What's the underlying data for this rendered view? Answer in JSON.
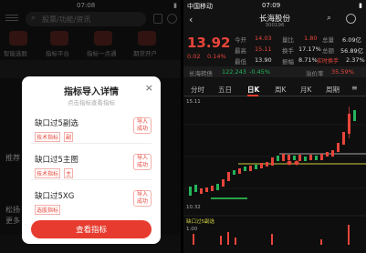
{
  "left": {
    "status": {
      "time": "07:08"
    },
    "search_placeholder": "股票/功能/资讯",
    "nav_items": [
      "智能选股",
      "指标平台",
      "指标一点通",
      "期货开户"
    ],
    "bg_labels": [
      "推荐",
      "松扬",
      "更多"
    ],
    "modal": {
      "title": "指标导入详情",
      "subtitle": "点击指标查看指标",
      "items": [
        {
          "name": "缺口过5副选",
          "tag1": "技术指标",
          "tag2": "副",
          "status": "导入\n成功"
        },
        {
          "name": "缺口过5主图",
          "tag1": "技术指标",
          "tag2": "主",
          "status": "导入\n成功"
        },
        {
          "name": "缺口过5XG",
          "tag1": "选股指标",
          "tag2": "",
          "status": "导入\n成功"
        }
      ],
      "button": "查看指标",
      "close": "×"
    }
  },
  "right": {
    "status": {
      "carrier": "中国移动",
      "time": "07:09"
    },
    "stock_name": "长海股份",
    "stock_code": "300196",
    "price": "13.92",
    "change": "0.02",
    "change_pct": "0.14%",
    "stats": [
      [
        "今开",
        "14.03",
        "量比",
        "1.80",
        "总量",
        "6.09亿"
      ],
      [
        "最高",
        "15.11",
        "换手",
        "17.17%",
        "总额",
        "56.89亿"
      ],
      [
        "最低",
        "13.90",
        "振幅",
        "8.71%",
        "实时换手",
        "2.37%"
      ]
    ],
    "convert": {
      "label": "长海转债",
      "value": "122.243",
      "pct": "-0.45%",
      "premium_label": "溢价率",
      "premium": "35.59%"
    },
    "tabs": [
      "分时",
      "五日",
      "日K",
      "周K",
      "月K",
      "周期"
    ],
    "active_tab": "日K",
    "axis_top": "15.11",
    "axis_bottom": "10.32",
    "indicator_text": "缺口过5副选",
    "sub_label": "1.00",
    "colors": {
      "up": "#e8453a",
      "down": "#24b55b",
      "accent": "#e63b2e"
    }
  }
}
